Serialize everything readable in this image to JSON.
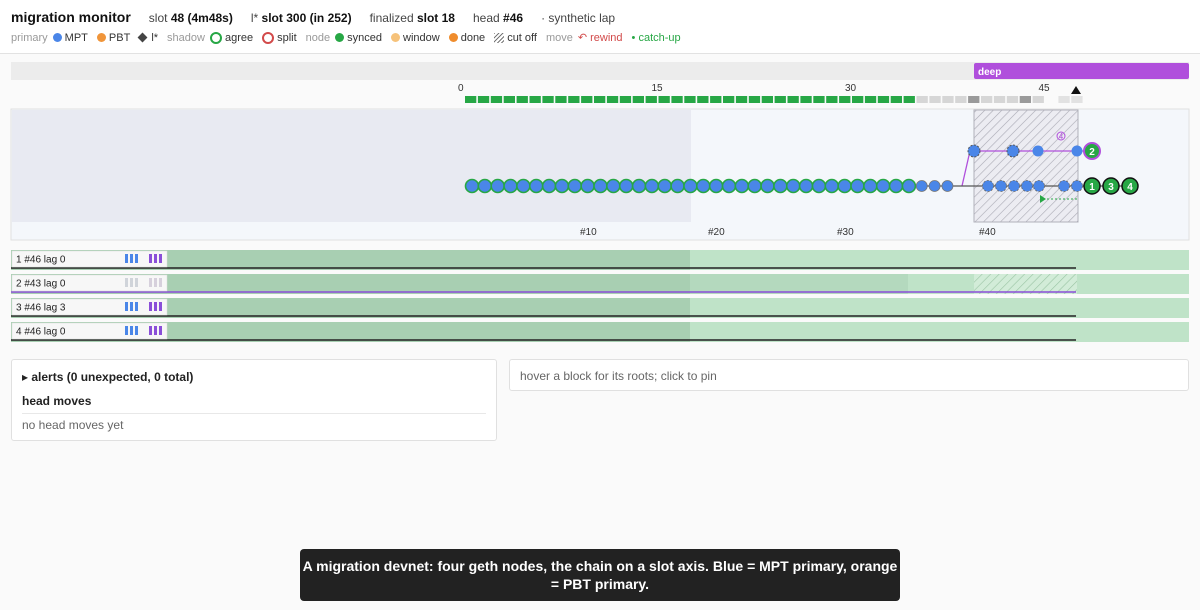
{
  "header": {
    "title": "migration monitor",
    "slot": {
      "label": "slot",
      "value": "48 (4m48s)"
    },
    "lstar": {
      "label": "l*",
      "value": "slot 300 (in 252)"
    },
    "finalized": {
      "label": "finalized",
      "value": "slot 18"
    },
    "head": {
      "label": "head",
      "value": "#46"
    },
    "mode": "· synthetic lap"
  },
  "legend": {
    "primary_label": "primary",
    "mpt": "MPT",
    "pbt": "PBT",
    "lstar": "l*",
    "shadow_label": "shadow",
    "agree": "agree",
    "split": "split",
    "node_label": "node",
    "synced": "synced",
    "window": "window",
    "done": "done",
    "cutoff": "cut off",
    "move_label": "move",
    "rewind": "↶ rewind",
    "catchup": "• catch-up"
  },
  "colors": {
    "mpt": "#4a86e8",
    "pbt": "#f0953a",
    "synced": "#27a745",
    "window": "#f6c27a",
    "done": "#ef8c2c",
    "deep": "#b04fdc",
    "split": "#d24a4a"
  },
  "timeline": {
    "deep_label": "deep",
    "slot_ticks": [
      0,
      15,
      30,
      45
    ],
    "block_ticks": [
      "#10",
      "#20",
      "#30",
      "#40"
    ],
    "slot_blocks": {
      "synced": 35,
      "total": 48
    },
    "node_badges": [
      "2",
      "1",
      "3",
      "4"
    ],
    "fork_marker": "4"
  },
  "nodes": [
    {
      "id": 1,
      "label": "1 #46 lag 0"
    },
    {
      "id": 2,
      "label": "2 #43 lag 0"
    },
    {
      "id": 3,
      "label": "3 #46 lag 3"
    },
    {
      "id": 4,
      "label": "4 #46 lag 0"
    }
  ],
  "alerts": {
    "title": "▸ alerts (0 unexpected, 0 total)",
    "head_moves_title": "head moves",
    "head_moves_empty": "no head moves yet"
  },
  "hover": {
    "text": "hover a block for its roots; click to pin"
  },
  "caption": "A migration devnet: four geth nodes, the chain on a slot axis. Blue = MPT primary, orange = PBT primary."
}
